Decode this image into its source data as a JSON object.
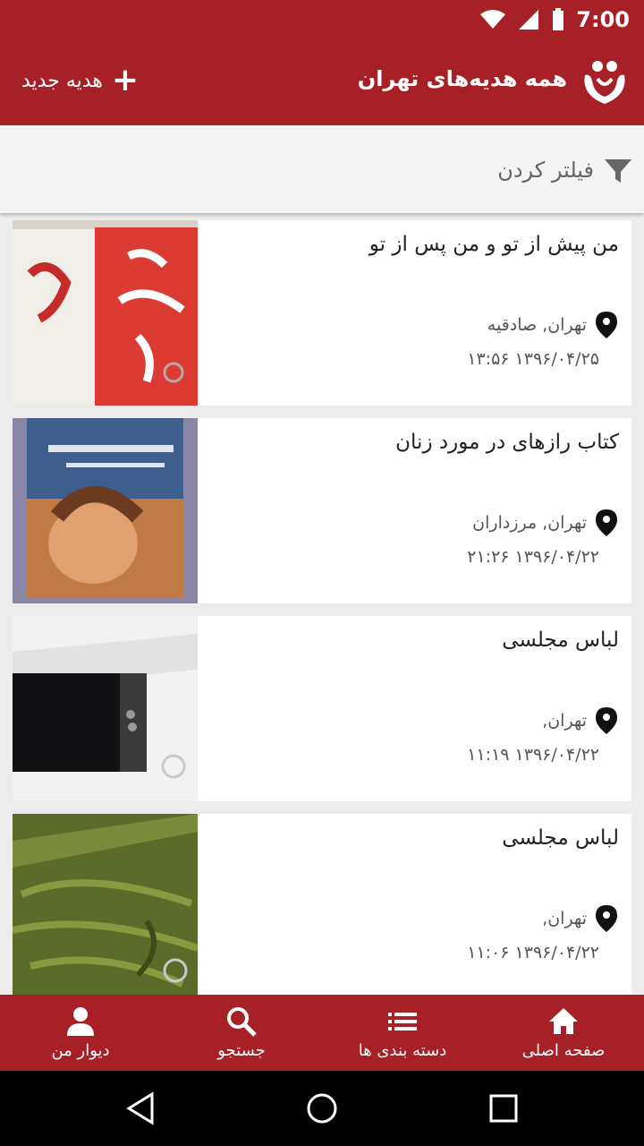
{
  "status_bar": {
    "time": "7:00"
  },
  "app_bar": {
    "title": "همه هدیه‌های تهران",
    "new_gift_label": "هدیه جدید",
    "logo_icon": "divar-gift-logo"
  },
  "filter": {
    "label": "فیلتر کردن",
    "icon": "filter-icon"
  },
  "items": [
    {
      "title": "من پیش از تو و من پس از تو",
      "location": "تهران, صادقیه",
      "datetime": "۱۳۹۶/۰۴/۲۵ ۱۳:۵۶"
    },
    {
      "title": "کتاب رازهای در مورد زنان",
      "location": "تهران, مرزداران",
      "datetime": "۱۳۹۶/۰۴/۲۲ ۲۱:۲۶"
    },
    {
      "title": "لباس مجلسی",
      "location": "تهران,",
      "datetime": "۱۳۹۶/۰۴/۲۲ ۱۱:۱۹"
    },
    {
      "title": "لباس مجلسی",
      "location": "تهران,",
      "datetime": "۱۳۹۶/۰۴/۲۲ ۱۱:۰۶"
    }
  ],
  "bottom_nav": {
    "home": "صفحه اصلی",
    "categories": "دسته بندی ها",
    "search": "جستجو",
    "my_wall": "دیوار من"
  },
  "colors": {
    "primary": "#a72026",
    "background": "#ececec"
  }
}
